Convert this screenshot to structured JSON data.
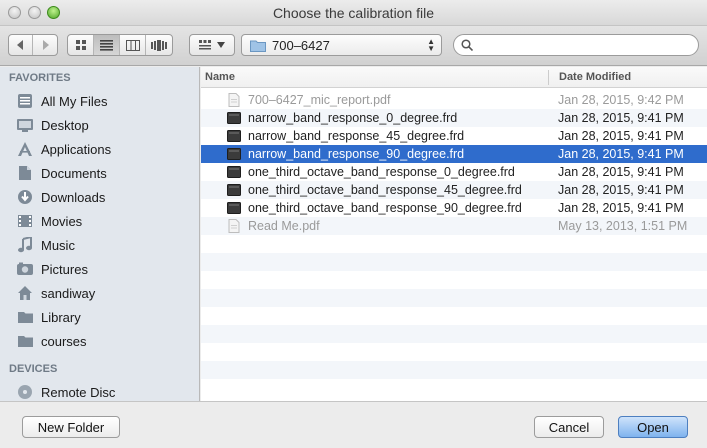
{
  "window": {
    "title": "Choose the calibration file"
  },
  "toolbar": {
    "path_label": "700–6427",
    "search_placeholder": ""
  },
  "sidebar": {
    "favorites_header": "FAVORITES",
    "favorites": [
      {
        "label": "All My Files",
        "icon": "all-files-icon"
      },
      {
        "label": "Desktop",
        "icon": "desktop-icon"
      },
      {
        "label": "Applications",
        "icon": "applications-icon"
      },
      {
        "label": "Documents",
        "icon": "documents-icon"
      },
      {
        "label": "Downloads",
        "icon": "downloads-icon"
      },
      {
        "label": "Movies",
        "icon": "movies-icon"
      },
      {
        "label": "Music",
        "icon": "music-icon"
      },
      {
        "label": "Pictures",
        "icon": "pictures-icon"
      },
      {
        "label": "sandiway",
        "icon": "home-icon"
      },
      {
        "label": "Library",
        "icon": "folder-icon"
      },
      {
        "label": "courses",
        "icon": "folder-icon"
      }
    ],
    "devices_header": "DEVICES",
    "devices": [
      {
        "label": "Remote Disc",
        "icon": "disc-icon"
      }
    ]
  },
  "filelist": {
    "col_name": "Name",
    "col_date": "Date Modified",
    "files": [
      {
        "name": "700–6427_mic_report.pdf",
        "date": "Jan 28, 2015, 9:42 PM",
        "enabled": false,
        "selected": false,
        "icon": "pdf-file-icon"
      },
      {
        "name": "narrow_band_response_0_degree.frd",
        "date": "Jan 28, 2015, 9:41 PM",
        "enabled": true,
        "selected": false,
        "icon": "frd-file-icon"
      },
      {
        "name": "narrow_band_response_45_degree.frd",
        "date": "Jan 28, 2015, 9:41 PM",
        "enabled": true,
        "selected": false,
        "icon": "frd-file-icon"
      },
      {
        "name": "narrow_band_response_90_degree.frd",
        "date": "Jan 28, 2015, 9:41 PM",
        "enabled": true,
        "selected": true,
        "icon": "frd-file-icon"
      },
      {
        "name": "one_third_octave_band_response_0_degree.frd",
        "date": "Jan 28, 2015, 9:41 PM",
        "enabled": true,
        "selected": false,
        "icon": "frd-file-icon"
      },
      {
        "name": "one_third_octave_band_response_45_degree.frd",
        "date": "Jan 28, 2015, 9:41 PM",
        "enabled": true,
        "selected": false,
        "icon": "frd-file-icon"
      },
      {
        "name": "one_third_octave_band_response_90_degree.frd",
        "date": "Jan 28, 2015, 9:41 PM",
        "enabled": true,
        "selected": false,
        "icon": "frd-file-icon"
      },
      {
        "name": "Read Me.pdf",
        "date": "May 13, 2013, 1:51 PM",
        "enabled": false,
        "selected": false,
        "icon": "pdf-file-icon"
      }
    ]
  },
  "buttons": {
    "new_folder": "New Folder",
    "cancel": "Cancel",
    "open": "Open"
  },
  "colors": {
    "selection": "#2f6ccc",
    "sidebar_bg": "#e2e7ed",
    "open_button": "#7fb3ee"
  }
}
